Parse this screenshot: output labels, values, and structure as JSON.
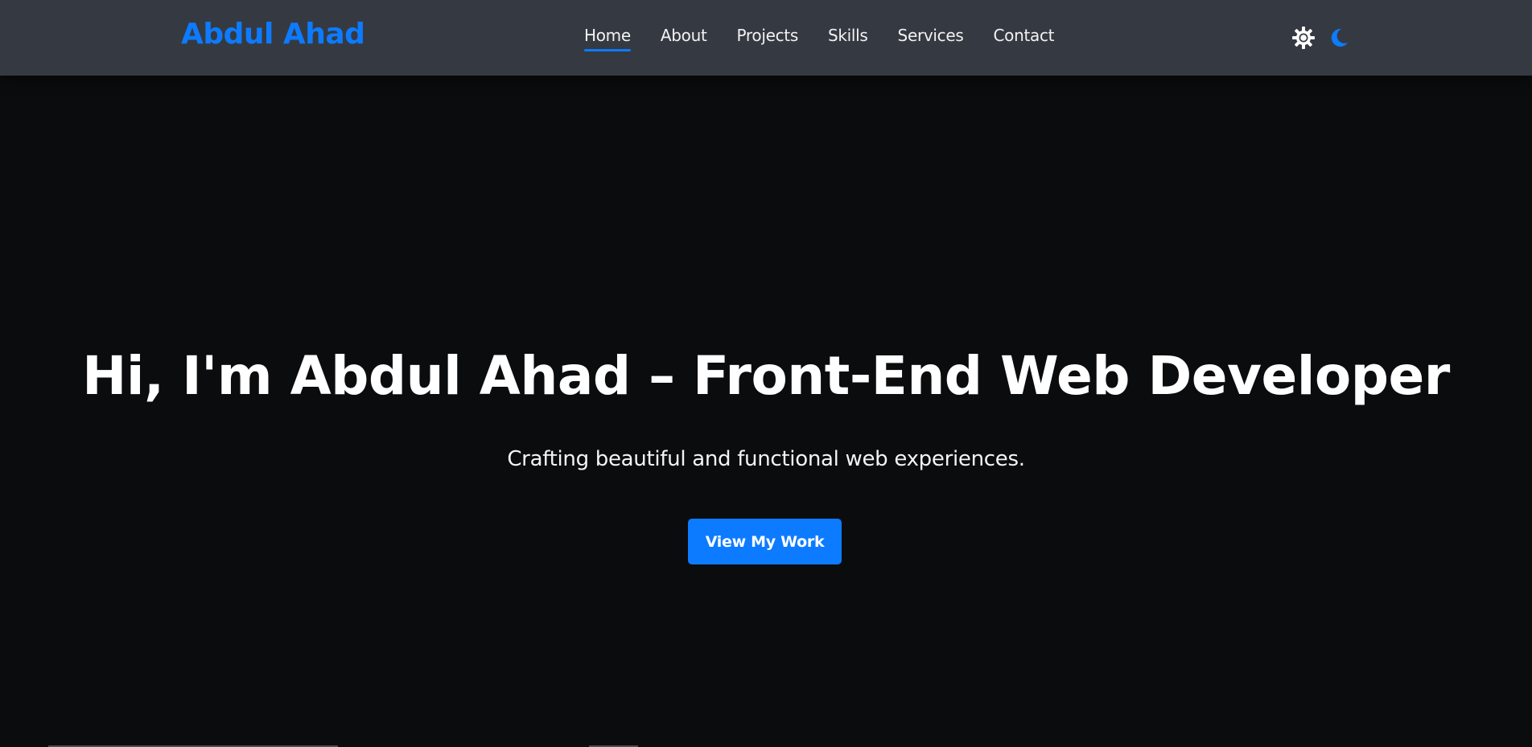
{
  "header": {
    "brand": "Abdul Ahad",
    "nav": [
      {
        "label": "Home",
        "active": true
      },
      {
        "label": "About",
        "active": false
      },
      {
        "label": "Projects",
        "active": false
      },
      {
        "label": "Skills",
        "active": false
      },
      {
        "label": "Services",
        "active": false
      },
      {
        "label": "Contact",
        "active": false
      }
    ],
    "theme_icons": [
      "sun-gear-icon",
      "moon-icon"
    ]
  },
  "hero": {
    "title": "Hi, I'm Abdul Ahad – Front-End Web Developer",
    "subtitle": "Crafting beautiful and functional web experiences.",
    "cta_label": "View My Work"
  },
  "colors": {
    "accent": "#0d7bff",
    "navbar_bg": "#353a42",
    "page_bg": "#0b0c0e",
    "text": "#ffffff"
  }
}
